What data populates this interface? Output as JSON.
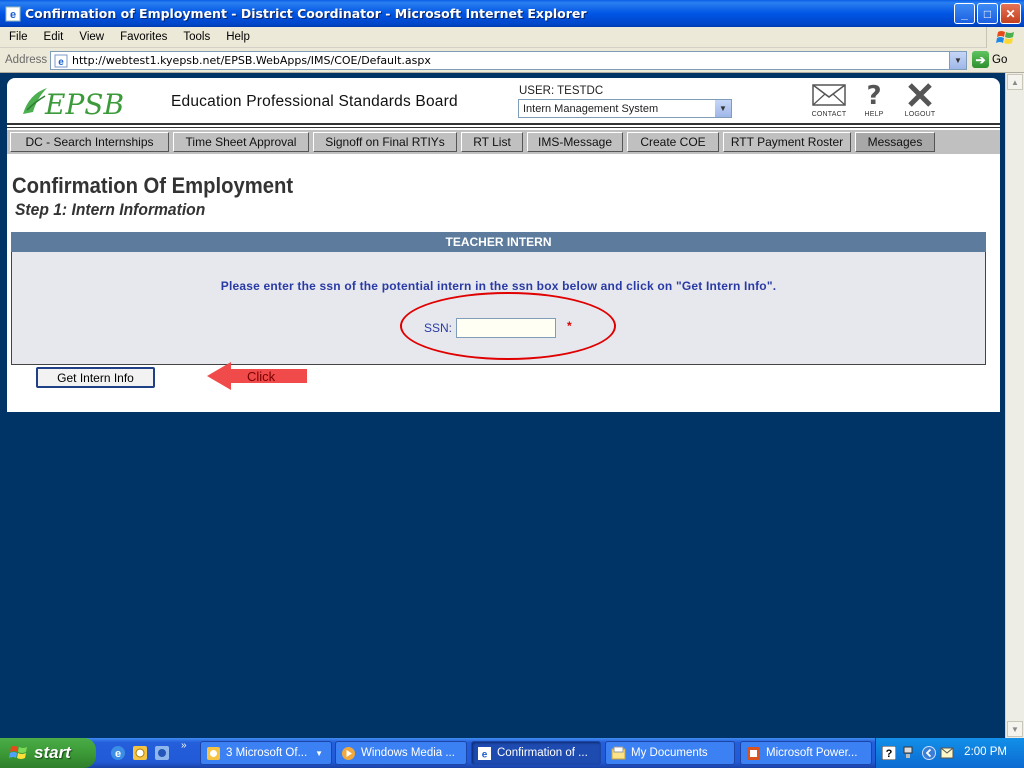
{
  "window": {
    "title": "Confirmation of Employment - District Coordinator - Microsoft Internet Explorer",
    "buttons": {
      "minimize": "_",
      "maximize": "□",
      "close": "✕"
    }
  },
  "menu": [
    "File",
    "Edit",
    "View",
    "Favorites",
    "Tools",
    "Help"
  ],
  "address_bar": {
    "label": "Address",
    "url": "http://webtest1.kyepsb.net/EPSB.WebApps/IMS/COE/Default.aspx",
    "go_label": "Go"
  },
  "header": {
    "logo_text": "EPSB",
    "org_title": "Education Professional Standards Board",
    "user_label": "USER: TESTDC",
    "system_select": "Intern Management System",
    "icons": [
      {
        "name": "contact-icon",
        "label": "CONTACT"
      },
      {
        "name": "help-icon",
        "label": "HELP"
      },
      {
        "name": "logout-icon",
        "label": "LOGOUT"
      }
    ]
  },
  "nav": [
    {
      "label": "DC - Search Internships"
    },
    {
      "label": "Time Sheet Approval"
    },
    {
      "label": "Signoff on Final RTIYs"
    },
    {
      "label": "RT List"
    },
    {
      "label": "IMS-Message"
    },
    {
      "label": "Create COE"
    },
    {
      "label": "RTT Payment Roster"
    },
    {
      "label": "Messages"
    }
  ],
  "main": {
    "heading": "Confirmation Of Employment",
    "subheading": "Step 1: Intern Information",
    "panel_title": "TEACHER INTERN",
    "instructions": "Please enter the ssn of the potential intern in the ssn box below and click on \"Get Intern Info\".",
    "ssn_label": "SSN:",
    "ssn_value": "",
    "required_marker": "*",
    "button_label": "Get Intern Info",
    "annotation_label": "Click"
  },
  "colors": {
    "panel_header": "#5d7b9d",
    "instruction_text": "#2a3aa5",
    "annotation_red": "#e00000",
    "background": "#003366"
  },
  "taskbar": {
    "start_label": "start",
    "tasks": [
      {
        "label": "3 Microsoft Of...",
        "icon": "outlook-icon",
        "active": false
      },
      {
        "label": "Windows Media ...",
        "icon": "media-player-icon",
        "active": false
      },
      {
        "label": "Confirmation of ...",
        "icon": "ie-icon",
        "active": true
      },
      {
        "label": "My Documents",
        "icon": "folder-icon",
        "active": false
      },
      {
        "label": "Microsoft Power...",
        "icon": "powerpoint-icon",
        "active": false
      }
    ],
    "clock": "2:00 PM"
  }
}
